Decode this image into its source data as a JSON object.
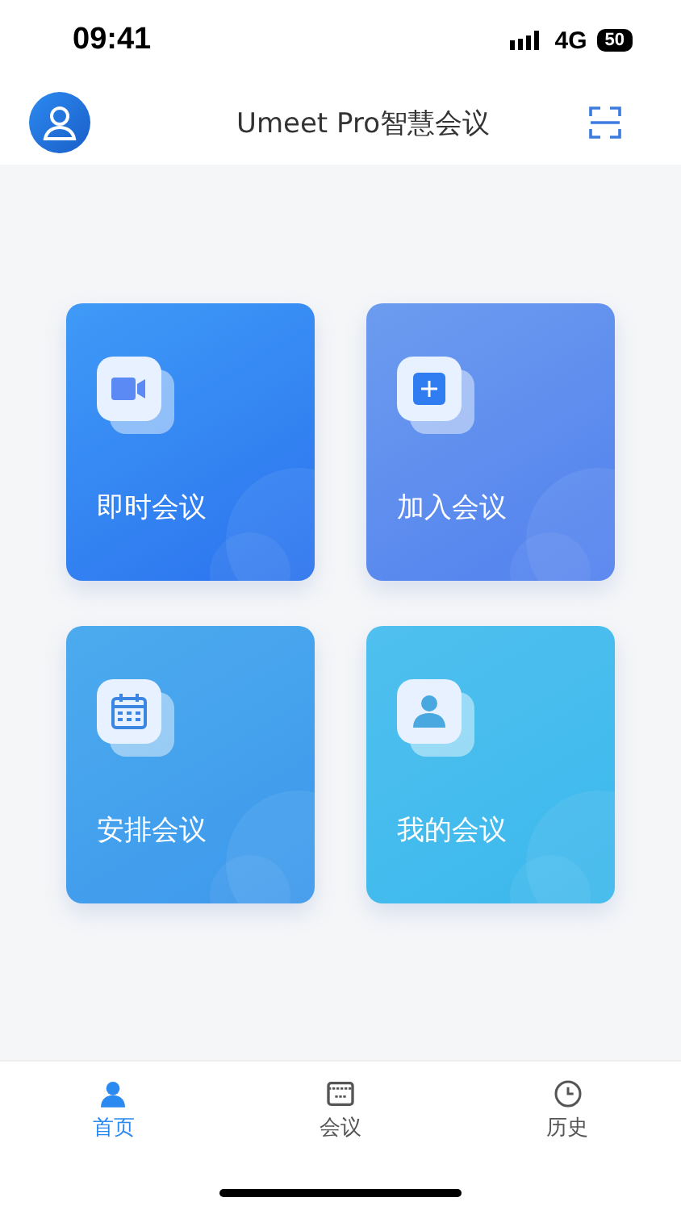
{
  "status_bar": {
    "time": "09:41",
    "network": "4G",
    "battery": "50"
  },
  "header": {
    "title": "Umeet Pro智慧会议"
  },
  "actions": [
    {
      "kind": "video",
      "label": "即时会议"
    },
    {
      "kind": "join",
      "label": "加入会议"
    },
    {
      "kind": "schedule",
      "label": "安排会议"
    },
    {
      "kind": "mine",
      "label": "我的会议"
    }
  ],
  "tab_bar": [
    {
      "kind": "home",
      "label": "首页",
      "selected": true
    },
    {
      "kind": "meetings",
      "label": "会议",
      "selected": false
    },
    {
      "kind": "history",
      "label": "历史",
      "selected": false
    }
  ]
}
